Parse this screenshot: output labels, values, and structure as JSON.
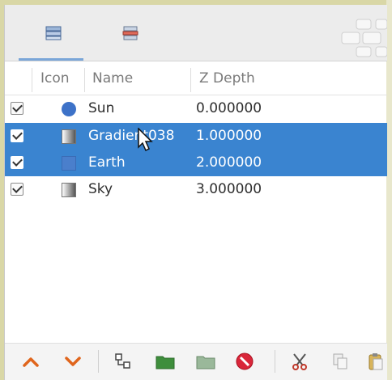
{
  "tabs": [
    {
      "icon": "layers-icon"
    },
    {
      "icon": "layers-red-icon"
    }
  ],
  "columns": {
    "icon": "Icon",
    "name": "Name",
    "zdepth": "Z Depth"
  },
  "rows": [
    {
      "checked": true,
      "icon": "circle-icon",
      "name": "Sun",
      "zdepth": "0.000000",
      "selected": false
    },
    {
      "checked": true,
      "icon": "gradient-icon",
      "name": "Gradient038",
      "zdepth": "1.000000",
      "selected": true
    },
    {
      "checked": true,
      "icon": "flat-color-icon",
      "name": "Earth",
      "zdepth": "2.000000",
      "selected": true
    },
    {
      "checked": true,
      "icon": "gradient-icon",
      "name": "Sky",
      "zdepth": "3.000000",
      "selected": false
    }
  ],
  "toolbar": [
    "raise-layer-icon",
    "lower-layer-icon",
    "group-layers-icon",
    "new-folder-icon",
    "encapsulate-icon",
    "delete-layer-icon",
    "cut-icon",
    "copy-icon",
    "paste-icon"
  ],
  "colors": {
    "selection": "#3a84d0",
    "accent": "#7aa6d8",
    "frame": "#d9d7a6"
  }
}
